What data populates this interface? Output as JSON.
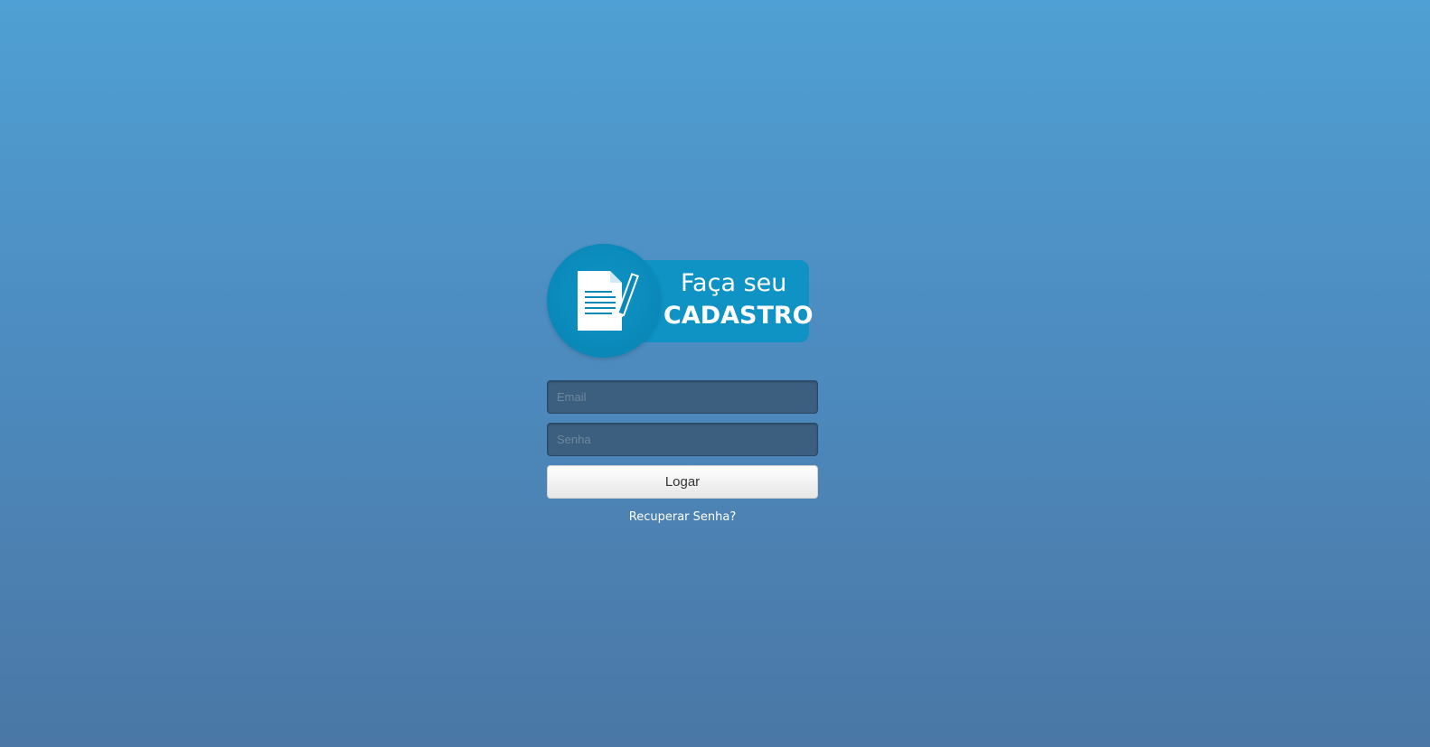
{
  "logo": {
    "line1": "Faça seu",
    "line2": "CADASTRO",
    "icon": "document-pen-icon",
    "colors": {
      "banner": "#0e93c4",
      "circle": "#0a88b8"
    }
  },
  "form": {
    "email_placeholder": "Email",
    "email_value": "",
    "password_placeholder": "Senha",
    "password_value": "",
    "submit_label": "Logar"
  },
  "recover": {
    "label": "Recuperar Senha?"
  },
  "colors": {
    "background_top": "#4fa0d4",
    "background_bottom": "#4a77a5",
    "field_background": "#3c5f80"
  }
}
